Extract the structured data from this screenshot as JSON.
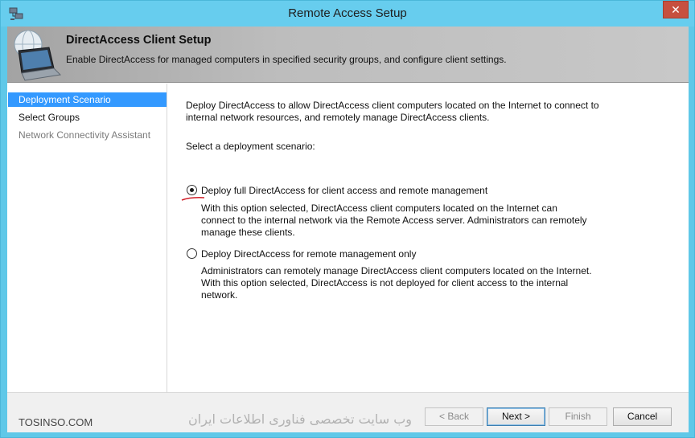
{
  "window": {
    "title": "Remote Access Setup",
    "close_label": "✕"
  },
  "banner": {
    "title": "DirectAccess Client Setup",
    "subtitle": "Enable DirectAccess for managed computers in specified security groups, and configure client settings.",
    "icon": "laptop-globe-icon"
  },
  "nav": {
    "items": [
      {
        "label": "Deployment Scenario",
        "state": "selected"
      },
      {
        "label": "Select Groups",
        "state": "normal"
      },
      {
        "label": "Network Connectivity Assistant",
        "state": "disabled"
      }
    ]
  },
  "content": {
    "intro_line1": "Deploy DirectAccess to allow DirectAccess client computers located on the Internet to connect to",
    "intro_line2": "internal network resources, and remotely manage DirectAccess clients.",
    "select_label": "Select a deployment scenario:",
    "options": [
      {
        "label": "Deploy full DirectAccess for client access and remote management",
        "checked": true,
        "desc1": "With this option selected, DirectAccess client computers located on the Internet can",
        "desc2": "connect to the internal network via the Remote Access server. Administrators can remotely",
        "desc3": "manage these clients."
      },
      {
        "label": "Deploy DirectAccess for remote management only",
        "checked": false,
        "desc1": "Administrators can remotely manage DirectAccess client computers located on the Internet.",
        "desc2": "With this option selected, DirectAccess is not deployed for client access to the internal",
        "desc3": "network."
      }
    ]
  },
  "footer": {
    "back_label": "< Back",
    "next_label": "Next >",
    "finish_label": "Finish",
    "cancel_label": "Cancel",
    "watermark_left": "TOSINSO.COM",
    "watermark_right": "وب سایت تخصصی فناوری اطلاعات ایران"
  },
  "colors": {
    "titlebar": "#67cdee",
    "selected": "#3399ff",
    "close": "#c7503f",
    "annotation": "#d0202a"
  }
}
